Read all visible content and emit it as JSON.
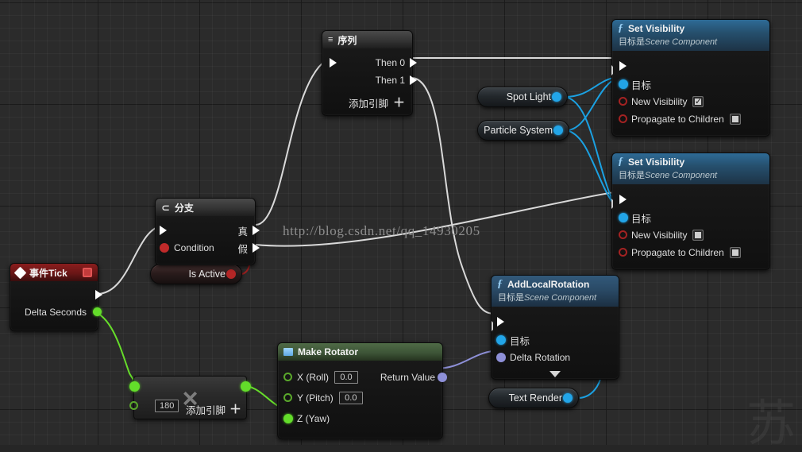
{
  "app": {
    "title": "Unreal Engine Blueprint Event Graph"
  },
  "watermarks": {
    "url": "http://blog.csdn.net/qq_14930205",
    "glyph": "苏"
  },
  "colors": {
    "exec_wire": "#d9d9d9",
    "object_wire": "#1ba1e2",
    "float_wire": "#66dd2a",
    "struct_wire": "#8e90d8",
    "bool_wire": "#9e1f1f",
    "canvas": "#2b2b2b"
  },
  "nodes": {
    "event_tick": {
      "title": "事件Tick",
      "icon": "event-diamond-icon",
      "stop_icon": "stop-square-icon",
      "out_exec": "",
      "delta_seconds": "Delta Seconds"
    },
    "is_active": {
      "label": "Is Active"
    },
    "branch": {
      "title": "分支",
      "icon": "branch-icon",
      "condition": "Condition",
      "true_label": "真",
      "false_label": "假"
    },
    "sequence": {
      "title": "序列",
      "icon": "sequence-icon",
      "then0": "Then 0",
      "then1": "Then 1",
      "add_pin": "添加引脚"
    },
    "spot_light": {
      "label": "Spot Light"
    },
    "particle_system": {
      "label": "Particle System"
    },
    "text_render": {
      "label": "Text Render"
    },
    "set_visibility_1": {
      "title": "Set Visibility",
      "sub_prefix": "目标是",
      "sub_type": "Scene Component",
      "target": "目标",
      "new_visibility": "New Visibility",
      "new_visibility_checked": true,
      "propagate": "Propagate to Children",
      "propagate_checked": false
    },
    "set_visibility_2": {
      "title": "Set Visibility",
      "sub_prefix": "目标是",
      "sub_type": "Scene Component",
      "target": "目标",
      "new_visibility": "New Visibility",
      "new_visibility_checked": false,
      "propagate": "Propagate to Children",
      "propagate_checked": false
    },
    "add_local_rotation": {
      "title": "AddLocalRotation",
      "sub_prefix": "目标是",
      "sub_type": "Scene Component",
      "target": "目标",
      "delta_rotation": "Delta Rotation"
    },
    "make_rotator": {
      "title": "Make Rotator",
      "icon": "make-struct-icon",
      "x_roll": "X (Roll)",
      "x_roll_value": "0.0",
      "y_pitch": "Y (Pitch)",
      "y_pitch_value": "0.0",
      "z_yaw": "Z (Yaw)",
      "return_value": "Return Value"
    },
    "multiply": {
      "operator": "×",
      "value_b": "180",
      "add_pin": "添加引脚"
    }
  }
}
